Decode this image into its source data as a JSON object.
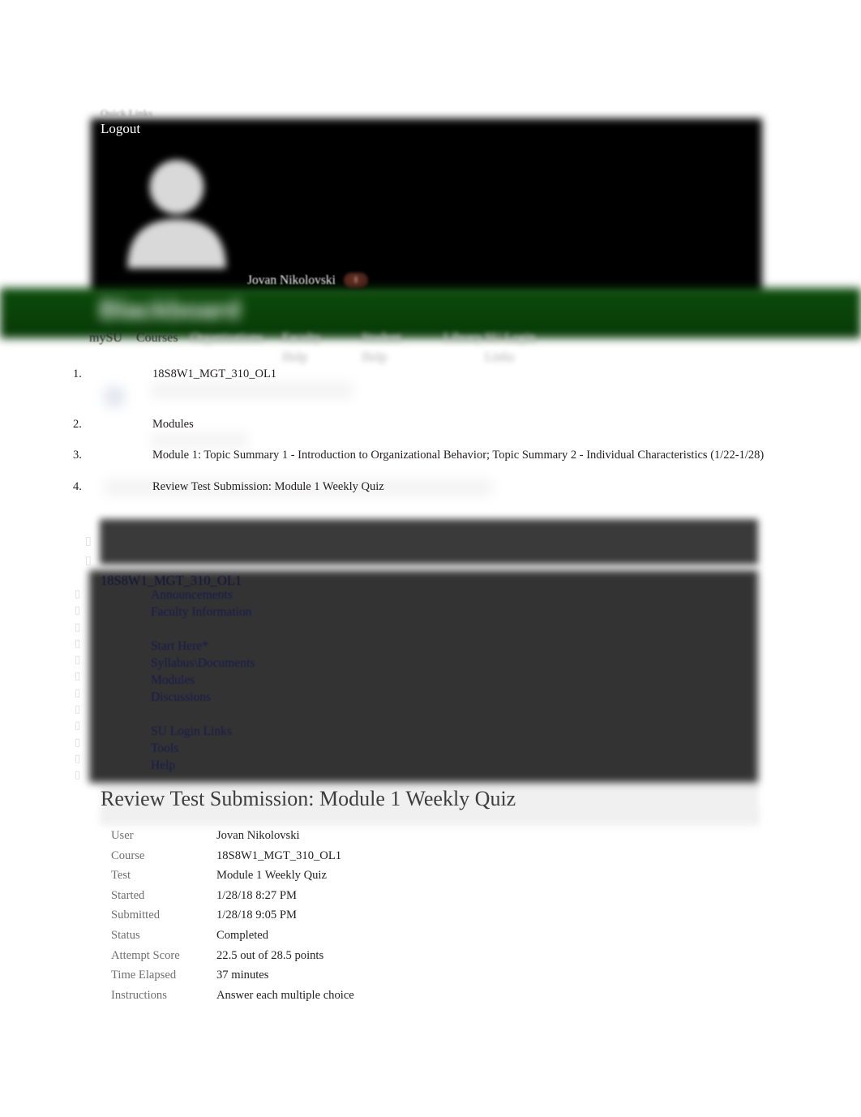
{
  "topbar": {
    "quick_links_label": "Quick Links",
    "logout_label": "Logout"
  },
  "identity": {
    "avatar_icon": "user-avatar-icon",
    "user_name": "Jovan Nikolovski",
    "notification_count": "1"
  },
  "brand": {
    "logo_text": "Blackboard",
    "bar_color": "#0a4209"
  },
  "global_nav": {
    "items": [
      {
        "label": "mySU"
      },
      {
        "label": "Courses"
      },
      {
        "label": "Organizations"
      },
      {
        "label": "Faculty Help"
      },
      {
        "label": "Student Help"
      },
      {
        "label": "Library"
      },
      {
        "label": "SU Login Links"
      }
    ]
  },
  "breadcrumb": {
    "items": [
      {
        "num": "1.",
        "text": "18S8W1_MGT_310_OL1"
      },
      {
        "num": "2.",
        "text": "Modules"
      },
      {
        "num": "3.",
        "text": "Module 1: Topic Summary 1 - Introduction to Organizational Behavior; Topic Summary 2 - Individual Characteristics (1/22-1/28)"
      },
      {
        "num": "4.",
        "text": "Review Test Submission: Module 1 Weekly Quiz"
      }
    ]
  },
  "course_menu": {
    "title": "18S8W1_MGT_310_OL1",
    "bullet_glyph": "▯",
    "header_glyph_count": 2,
    "bullet_count": 12,
    "links": [
      {
        "label": "Announcements"
      },
      {
        "label": "Faculty Information"
      },
      {
        "label": ""
      },
      {
        "label": "Start Here*"
      },
      {
        "label": "Syllabus\\Documents"
      },
      {
        "label": "Modules"
      },
      {
        "label": "Discussions"
      },
      {
        "label": ""
      },
      {
        "label": "SU Login Links"
      },
      {
        "label": "Tools"
      },
      {
        "label": "Help"
      }
    ]
  },
  "main": {
    "page_title": "Review Test Submission: Module 1 Weekly Quiz",
    "details": [
      {
        "label": "User",
        "value": "Jovan Nikolovski"
      },
      {
        "label": "Course",
        "value": "18S8W1_MGT_310_OL1"
      },
      {
        "label": "Test",
        "value": "Module 1 Weekly Quiz"
      },
      {
        "label": "Started",
        "value": "1/28/18 8:27 PM"
      },
      {
        "label": "Submitted",
        "value": "1/28/18 9:05 PM"
      },
      {
        "label": "Status",
        "value": "Completed"
      },
      {
        "label": "Attempt Score",
        "value": "22.5 out of 28.5 points"
      },
      {
        "label": "Time Elapsed",
        "value": "37 minutes"
      },
      {
        "label": "Instructions",
        "value": "Answer each multiple choice"
      }
    ]
  }
}
